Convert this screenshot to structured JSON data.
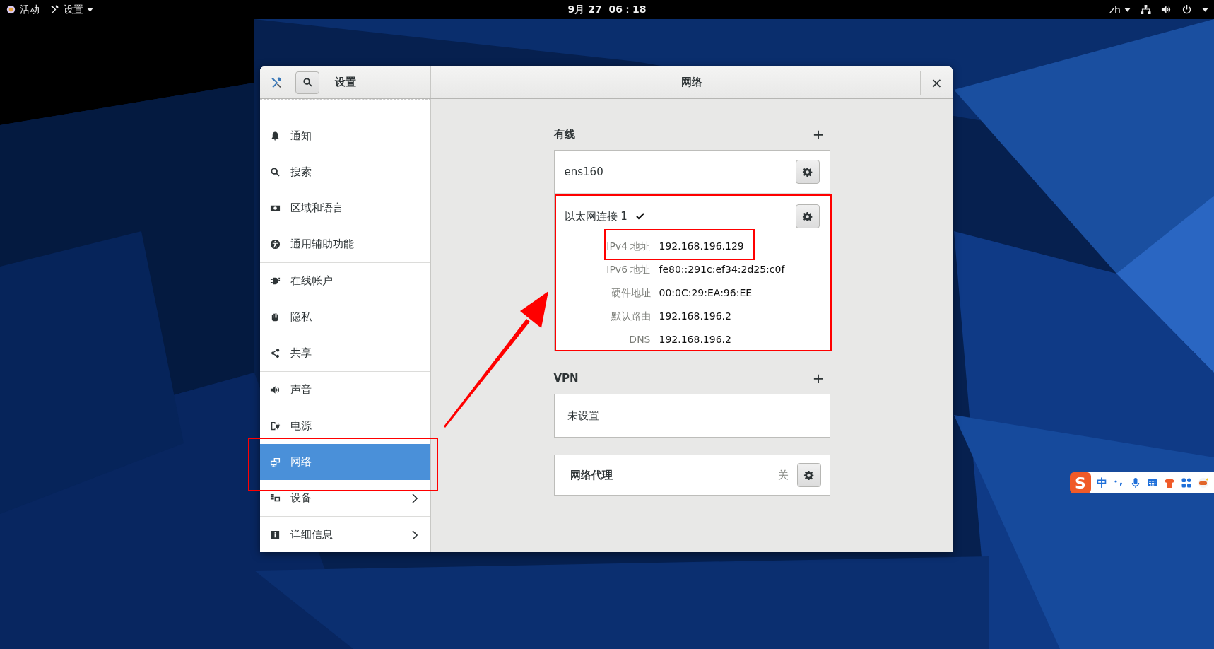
{
  "top_bar": {
    "activities": "活动",
    "app_menu": "设置",
    "clock": "9月 27  06：18",
    "language": "zh"
  },
  "window": {
    "sidebar_title": "设置",
    "title": "网络",
    "close": "×"
  },
  "sidebar": {
    "groups": [
      {
        "items": [
          {
            "label": "通知",
            "selected": false,
            "arrow": false
          },
          {
            "label": "搜索",
            "selected": false,
            "arrow": false
          },
          {
            "label": "区域和语言",
            "selected": false,
            "arrow": false
          },
          {
            "label": "通用辅助功能",
            "selected": false,
            "arrow": false
          }
        ]
      },
      {
        "items": [
          {
            "label": "在线帐户",
            "selected": false,
            "arrow": false
          },
          {
            "label": "隐私",
            "selected": false,
            "arrow": false
          },
          {
            "label": "共享",
            "selected": false,
            "arrow": false
          }
        ]
      },
      {
        "items": [
          {
            "label": "声音",
            "selected": false,
            "arrow": false
          },
          {
            "label": "电源",
            "selected": false,
            "arrow": false
          },
          {
            "label": "网络",
            "selected": true,
            "arrow": false
          },
          {
            "label": "设备",
            "selected": false,
            "arrow": true
          }
        ]
      },
      {
        "items": [
          {
            "label": "详细信息",
            "selected": false,
            "arrow": true
          }
        ]
      }
    ]
  },
  "wired": {
    "heading": "有线",
    "add": "+",
    "device": "ens160",
    "connection": {
      "name": "以太网连接 1",
      "connected": true,
      "details": [
        {
          "label": "IPv4 地址",
          "value": "192.168.196.129"
        },
        {
          "label": "IPv6 地址",
          "value": "fe80::291c:ef34:2d25:c0f"
        },
        {
          "label": "硬件地址",
          "value": "00:0C:29:EA:96:EE"
        },
        {
          "label": "默认路由",
          "value": "192.168.196.2"
        },
        {
          "label": "DNS",
          "value": "192.168.196.2"
        }
      ]
    }
  },
  "vpn": {
    "heading": "VPN",
    "add": "+",
    "empty": "未设置"
  },
  "proxy": {
    "label": "网络代理",
    "status": "关"
  },
  "ime_toolbar": {
    "logo": "S",
    "mode": "中"
  }
}
